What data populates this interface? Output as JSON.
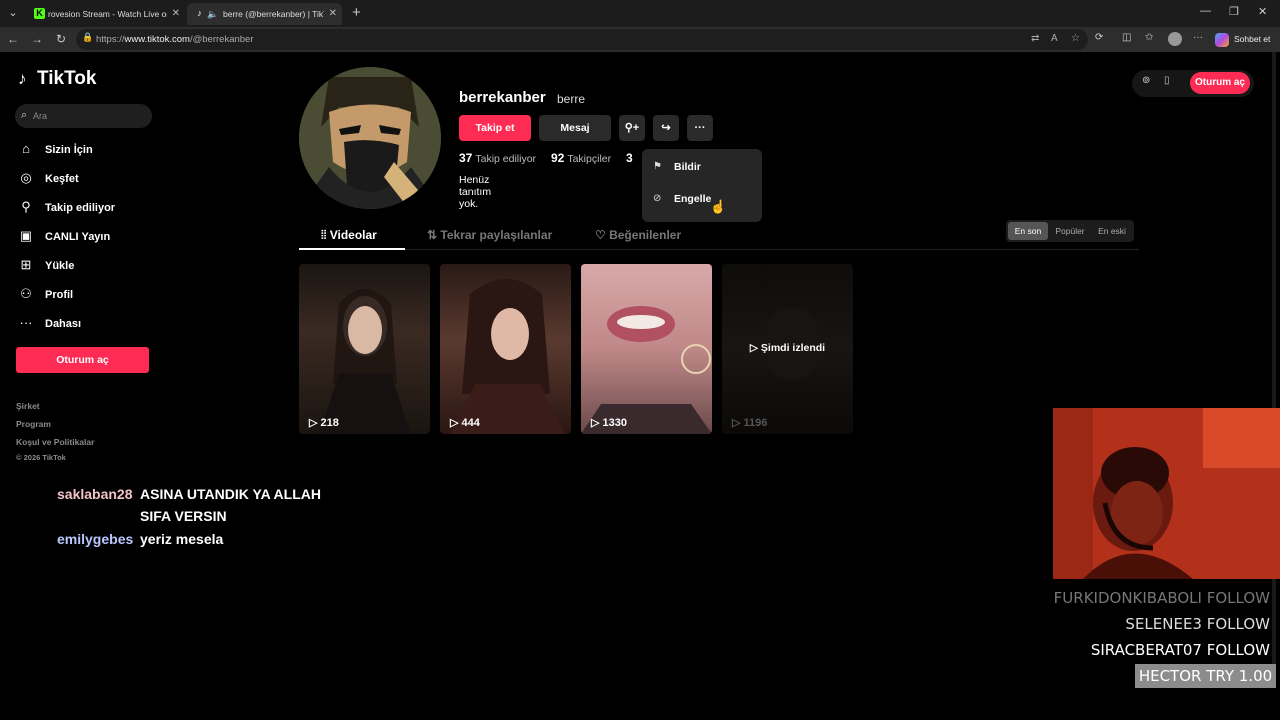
{
  "browser": {
    "tabs": [
      {
        "title": "rovesion Stream - Watch Live on K",
        "favicon": "K"
      },
      {
        "title": "berre (@berrekanber) | TikTok",
        "favicon": "tiktok-icon"
      }
    ],
    "url_prefix": "https://",
    "url_domain": "www.tiktok.com",
    "url_path": "/@berrekanber",
    "copilot_label": "Sohbet et"
  },
  "sidebar": {
    "logo": "TikTok",
    "search_placeholder": "Ara",
    "items": [
      {
        "label": "Sizin İçin",
        "icon": "home-icon"
      },
      {
        "label": "Keşfet",
        "icon": "compass-icon"
      },
      {
        "label": "Takip ediliyor",
        "icon": "following-icon"
      },
      {
        "label": "CANLI Yayın",
        "icon": "live-icon"
      },
      {
        "label": "Yükle",
        "icon": "upload-icon"
      },
      {
        "label": "Profil",
        "icon": "profile-icon"
      },
      {
        "label": "Dahası",
        "icon": "more-icon"
      }
    ],
    "login": "Oturum aç",
    "footer": [
      "Şirket",
      "Program",
      "Koşul ve Politikalar",
      "© 2026 TikTok"
    ]
  },
  "profile": {
    "username": "berrekanber",
    "nickname": "berre",
    "follow": "Takip et",
    "message": "Mesaj",
    "following_count": "37",
    "following_label": "Takip ediliyor",
    "followers_count": "92",
    "followers_label": "Takipçiler",
    "likes_count": "3",
    "bio": "Henüz tanıtım yok."
  },
  "dropdown": {
    "report": "Bildir",
    "block": "Engelle"
  },
  "top_right": {
    "login": "Oturum aç"
  },
  "tabs": {
    "videos": "Videolar",
    "reposts": "Tekrar paylaşılanlar",
    "liked": "Beğenilenler"
  },
  "sort": {
    "latest": "En son",
    "popular": "Popüler",
    "oldest": "En eski"
  },
  "videos": [
    {
      "views": "218"
    },
    {
      "views": "444"
    },
    {
      "views": "1330"
    },
    {
      "views": "1196",
      "watched": "Şimdi izlendi"
    }
  ],
  "chat": [
    {
      "user": "saklaban28",
      "message": "ASINA UTANDIK YA ALLAH",
      "user_color": "#f4c3c8"
    },
    {
      "user": "",
      "message": "SIFA VERSIN"
    },
    {
      "user": "emilygebes",
      "message": "yeriz mesela",
      "user_color": "#b8c8ff"
    }
  ],
  "overlay": {
    "follows": [
      "FURKIDONKIBABOLI  FOLLOW",
      "SELENEE3  FOLLOW",
      "SIRACBERAT07  FOLLOW"
    ],
    "hector": "HECTOR  TRY 1.00"
  }
}
